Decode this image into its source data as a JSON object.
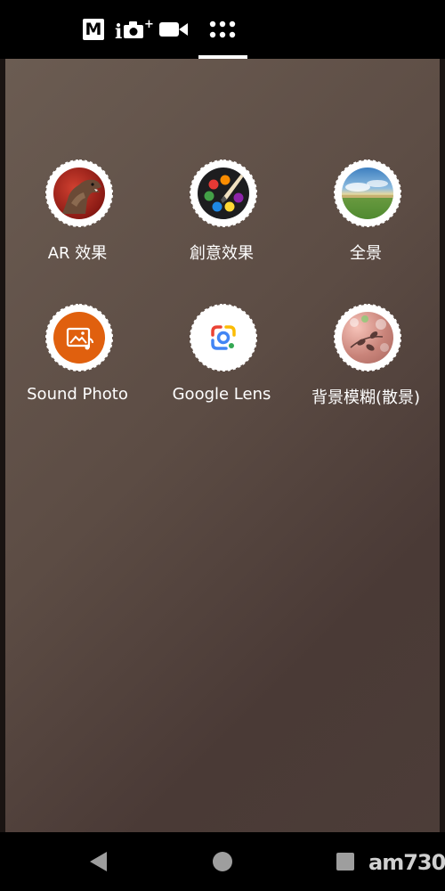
{
  "top_modes": {
    "manual_label": "M"
  },
  "apps": [
    {
      "label": "AR 效果"
    },
    {
      "label": "創意效果"
    },
    {
      "label": "全景"
    },
    {
      "label": "Sound Photo"
    },
    {
      "label": "Google Lens"
    },
    {
      "label": "背景模糊(散景)"
    }
  ],
  "watermark": {
    "text": "am730"
  }
}
